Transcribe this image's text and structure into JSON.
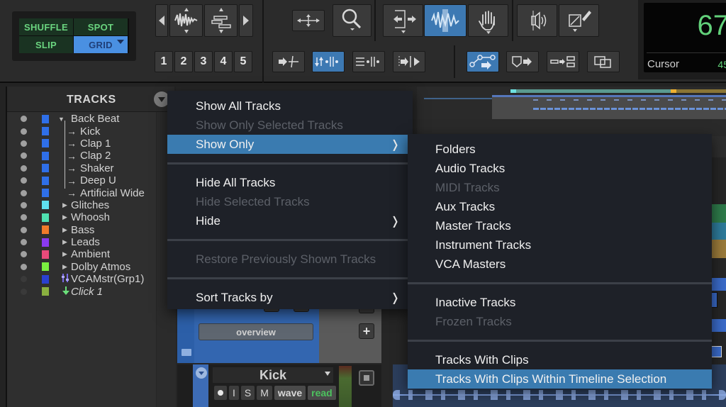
{
  "toolbar": {
    "edit_modes": [
      {
        "label": "SHUFFLE",
        "active": false
      },
      {
        "label": "SPOT",
        "active": false
      },
      {
        "label": "SLIP",
        "active": false
      },
      {
        "label": "GRID",
        "active": true
      }
    ],
    "zoom_presets": [
      "1",
      "2",
      "3",
      "4",
      "5"
    ],
    "tools": [
      {
        "name": "zoom-waveform-icon"
      },
      {
        "name": "zoom-track-height-icon"
      },
      {
        "name": "zoom-toggle-icon"
      },
      {
        "name": "zoomer-tool-icon"
      },
      {
        "name": "trim-tool-icon"
      },
      {
        "name": "selector-tool-icon",
        "active": true
      },
      {
        "name": "grabber-tool-icon"
      },
      {
        "name": "scrubber-tool-icon"
      },
      {
        "name": "pencil-tool-icon"
      }
    ],
    "colors": {
      "edit_mode_text": "#6ad47f",
      "edit_mode_active_bg": "#4a90e2",
      "tool_active_bg": "#3d79b3"
    }
  },
  "counter": {
    "main_value": "67",
    "label": "Cursor",
    "sub_value": "45",
    "color": "#62d17a"
  },
  "tracks_panel": {
    "title": "TRACKS",
    "tracks": [
      {
        "name": "Back Beat",
        "color": "#2f6fe8",
        "level": 0,
        "expander": "open",
        "active": true
      },
      {
        "name": "Kick",
        "color": "#2f6fe8",
        "level": 1,
        "expander": "child",
        "active": true
      },
      {
        "name": "Clap 1",
        "color": "#2f6fe8",
        "level": 1,
        "expander": "child",
        "active": true
      },
      {
        "name": "Clap 2",
        "color": "#2f6fe8",
        "level": 1,
        "expander": "child",
        "active": true
      },
      {
        "name": "Shaker",
        "color": "#2f6fe8",
        "level": 1,
        "expander": "child",
        "active": true
      },
      {
        "name": "Deep U",
        "color": "#2f6fe8",
        "level": 1,
        "expander": "child",
        "active": true
      },
      {
        "name": "Artificial Wide",
        "color": "#2f6fe8",
        "level": 1,
        "expander": "child",
        "active": true
      },
      {
        "name": "Glitches",
        "color": "#5fe0f0",
        "level": 0,
        "expander": "closed",
        "active": true
      },
      {
        "name": "Whoosh",
        "color": "#4fe0b0",
        "level": 0,
        "expander": "closed",
        "active": true
      },
      {
        "name": "Bass",
        "color": "#f07a2a",
        "level": 0,
        "expander": "closed",
        "active": true
      },
      {
        "name": "Leads",
        "color": "#8a3af0",
        "level": 0,
        "expander": "closed",
        "active": true
      },
      {
        "name": "Ambient",
        "color": "#e84a7a",
        "level": 0,
        "expander": "closed",
        "active": true
      },
      {
        "name": "Dolby Atmos",
        "color": "#7af040",
        "level": 0,
        "expander": "closed",
        "active": true
      },
      {
        "name": "VCAMstr(Grp1)",
        "color": "#2a40d0",
        "level": 0,
        "expander": "vca",
        "active": false
      },
      {
        "name": "Click 1",
        "color": "#8ab040",
        "level": 0,
        "expander": "click",
        "active": false,
        "italic": true
      }
    ]
  },
  "edit_window": {
    "folder_track": {
      "overview_label": "overview",
      "add_label": "+"
    },
    "kick_track": {
      "name": "Kick",
      "buttons": [
        "",
        "I",
        "S",
        "M"
      ],
      "view": "wave",
      "automation": "read"
    }
  },
  "context_menu": {
    "items": [
      {
        "label": "Show All Tracks",
        "enabled": true
      },
      {
        "label": "Show Only Selected Tracks",
        "enabled": false
      },
      {
        "label": "Show Only",
        "enabled": true,
        "submenu": true,
        "highlighted": true
      },
      {
        "separator": true
      },
      {
        "label": "Hide All Tracks",
        "enabled": true
      },
      {
        "label": "Hide Selected Tracks",
        "enabled": false
      },
      {
        "label": "Hide",
        "enabled": true,
        "submenu": true
      },
      {
        "separator": true
      },
      {
        "label": "Restore Previously Shown Tracks",
        "enabled": false
      },
      {
        "separator": true
      },
      {
        "label": "Sort Tracks by",
        "enabled": true,
        "submenu": true
      }
    ]
  },
  "submenu": {
    "items": [
      {
        "label": "Folders",
        "enabled": true
      },
      {
        "label": "Audio Tracks",
        "enabled": true
      },
      {
        "label": "MIDI Tracks",
        "enabled": false
      },
      {
        "label": "Aux Tracks",
        "enabled": true
      },
      {
        "label": "Master Tracks",
        "enabled": true
      },
      {
        "label": "Instrument Tracks",
        "enabled": true
      },
      {
        "label": "VCA Masters",
        "enabled": true
      },
      {
        "separator": true
      },
      {
        "label": "Inactive Tracks",
        "enabled": true
      },
      {
        "label": "Frozen Tracks",
        "enabled": false
      },
      {
        "separator": true
      },
      {
        "label": "Tracks With Clips",
        "enabled": true
      },
      {
        "label": "Tracks With Clips Within Timeline Selection",
        "enabled": true,
        "highlighted": true
      }
    ]
  },
  "chevron_glyph": "❭"
}
